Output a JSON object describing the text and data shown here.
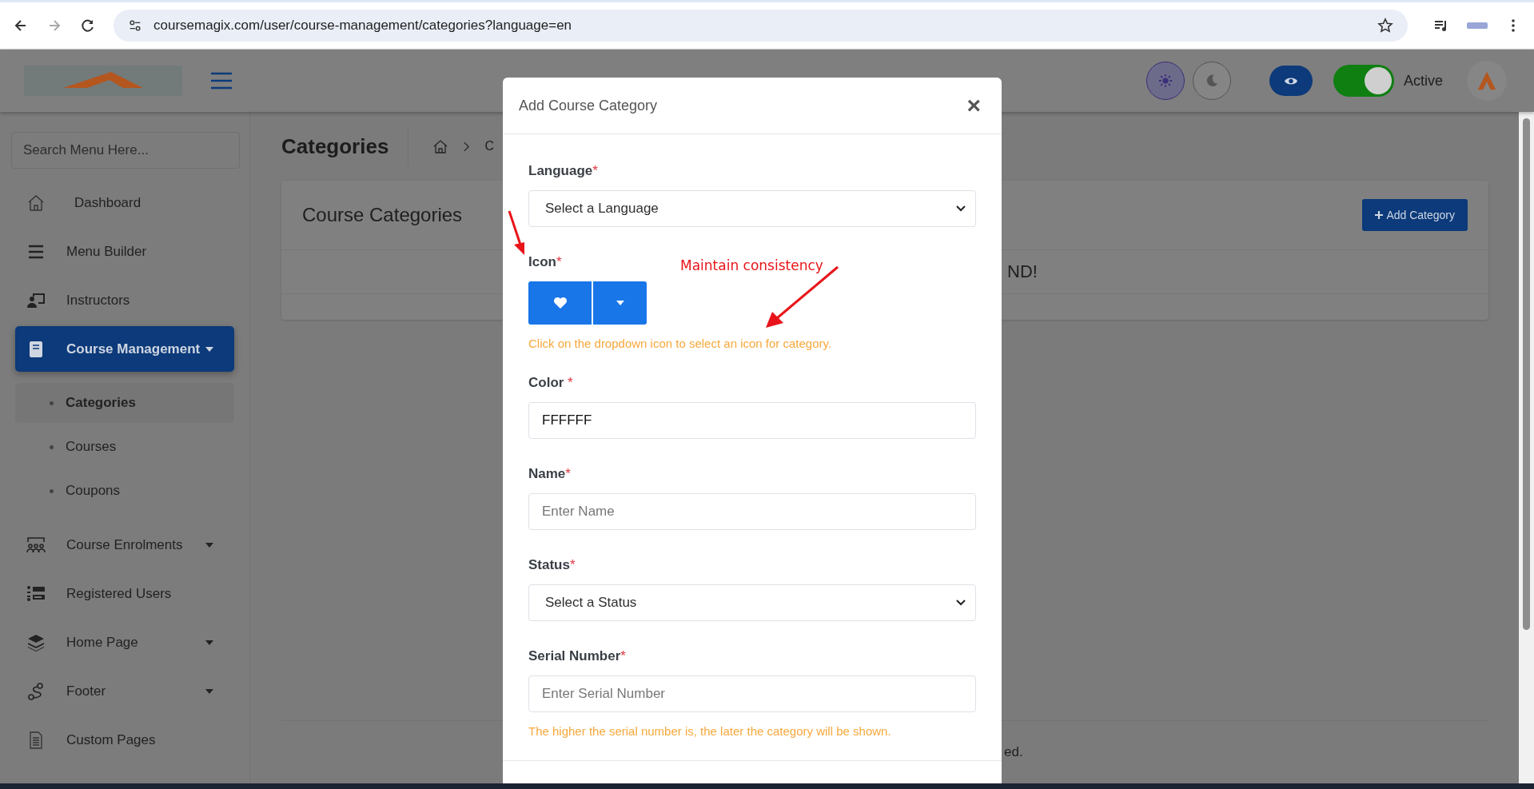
{
  "browser": {
    "url": "coursemagix.com/user/course-management/categories?language=en"
  },
  "header": {
    "status_toggle": {
      "on": true,
      "label": "Active"
    }
  },
  "sidebar": {
    "search_placeholder": "Search Menu Here...",
    "items": [
      {
        "label": "Dashboard",
        "selected": false,
        "dropdown": false
      },
      {
        "label": "Menu Builder",
        "selected": false,
        "dropdown": false
      },
      {
        "label": "Instructors",
        "selected": false,
        "dropdown": false
      },
      {
        "label": "Course Management",
        "selected": true,
        "dropdown": true,
        "children": [
          {
            "label": "Categories",
            "selected": true
          },
          {
            "label": "Courses",
            "selected": false
          },
          {
            "label": "Coupons",
            "selected": false
          }
        ]
      },
      {
        "label": "Course Enrolments",
        "selected": false,
        "dropdown": true
      },
      {
        "label": "Registered Users",
        "selected": false,
        "dropdown": false
      },
      {
        "label": "Home Page",
        "selected": false,
        "dropdown": true
      },
      {
        "label": "Footer",
        "selected": false,
        "dropdown": true
      },
      {
        "label": "Custom Pages",
        "selected": false,
        "dropdown": false
      }
    ]
  },
  "main": {
    "page_title": "Categories",
    "breadcrumb": [
      "C"
    ],
    "card": {
      "title": "Course Categories",
      "add_button": "Add Category",
      "empty_text": "ND!"
    },
    "footer_text": "ed."
  },
  "modal": {
    "title": "Add Course Category",
    "close": "×",
    "fields": [
      {
        "kind": "select",
        "label": "Language",
        "required_mark": "*",
        "placeholder": "Select a Language"
      },
      {
        "kind": "icon_picker",
        "label": "Icon",
        "required_mark": "*",
        "help": "Click on the dropdown icon to select an icon for category."
      },
      {
        "kind": "text",
        "label": "Color",
        "required_mark": " *",
        "value": "FFFFFF"
      },
      {
        "kind": "text",
        "label": "Name",
        "required_mark": "*",
        "placeholder": "Enter Name"
      },
      {
        "kind": "select",
        "label": "Status",
        "required_mark": "*",
        "placeholder": "Select a Status"
      },
      {
        "kind": "text",
        "label": "Serial Number",
        "required_mark": "*",
        "placeholder": "Enter Serial Number",
        "help": "The higher the serial number is, the later the category will be shown."
      }
    ]
  },
  "annotations": [
    {
      "text": "Maintain consistency"
    }
  ]
}
